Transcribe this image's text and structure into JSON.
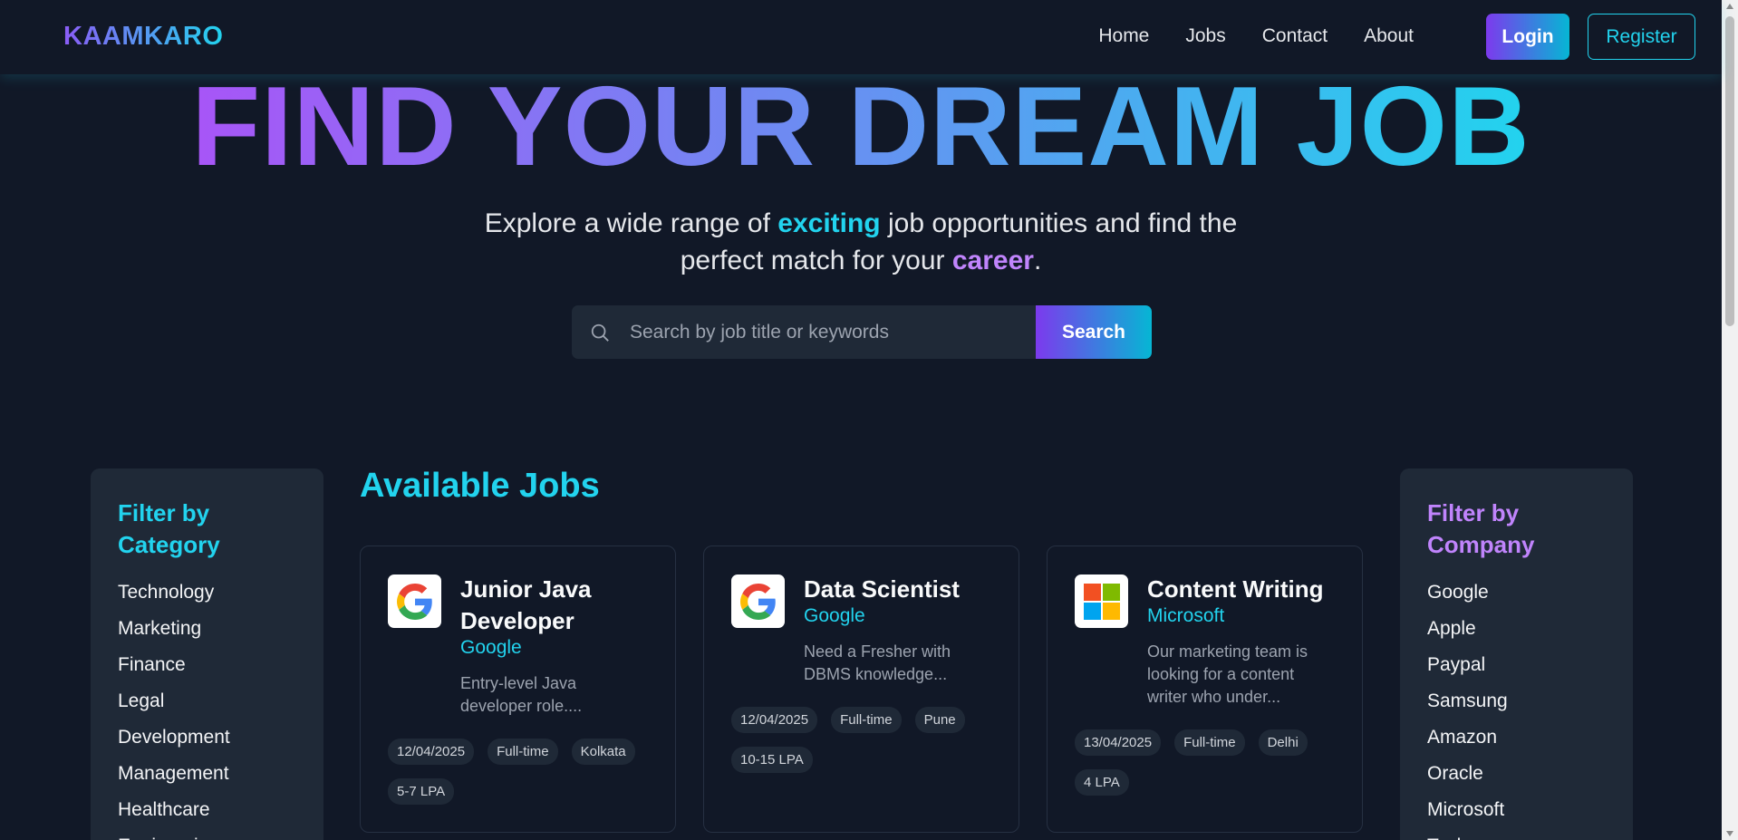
{
  "brand": "KAAMKARO",
  "nav": {
    "links": [
      "Home",
      "Jobs",
      "Contact",
      "About"
    ],
    "login": "Login",
    "register": "Register"
  },
  "hero": {
    "title": "FIND YOUR DREAM JOB",
    "subtitle_1": "Explore a wide range of ",
    "subtitle_hl1": "exciting",
    "subtitle_2": " job opportunities and find the perfect match for your ",
    "subtitle_hl2": "career",
    "subtitle_3": "."
  },
  "search": {
    "placeholder": "Search by job title or keywords",
    "button": "Search"
  },
  "jobs_title": "Available Jobs",
  "category_filter": {
    "title": "Filter by Category",
    "items": [
      "Technology",
      "Marketing",
      "Finance",
      "Legal",
      "Development",
      "Management",
      "Healthcare",
      "Engineering"
    ]
  },
  "company_filter": {
    "title": "Filter by Company",
    "items": [
      "Google",
      "Apple",
      "Paypal",
      "Samsung",
      "Amazon",
      "Oracle",
      "Microsoft",
      "Tesla"
    ]
  },
  "jobs": [
    {
      "title": "Junior Java Developer",
      "company": "Google",
      "logo": "google-logo",
      "description": "Entry-level Java developer role....",
      "date": "12/04/2025",
      "type": "Full-time",
      "location": "Kolkata",
      "salary": "5-7 LPA"
    },
    {
      "title": "Data Scientist",
      "company": "Google",
      "logo": "google-logo",
      "description": "Need a Fresher with DBMS knowledge...",
      "date": "12/04/2025",
      "type": "Full-time",
      "location": "Pune",
      "salary": "10-15 LPA"
    },
    {
      "title": "Content Writing",
      "company": "Microsoft",
      "logo": "microsoft-logo",
      "description": "Our marketing team is looking for a content writer who under...",
      "date": "13/04/2025",
      "type": "Full-time",
      "location": "Delhi",
      "salary": "4 LPA"
    }
  ],
  "colors": {
    "background": "#111827",
    "panel": "#1f2937",
    "accent_cyan": "#22d3ee",
    "accent_purple": "#a855f7"
  }
}
